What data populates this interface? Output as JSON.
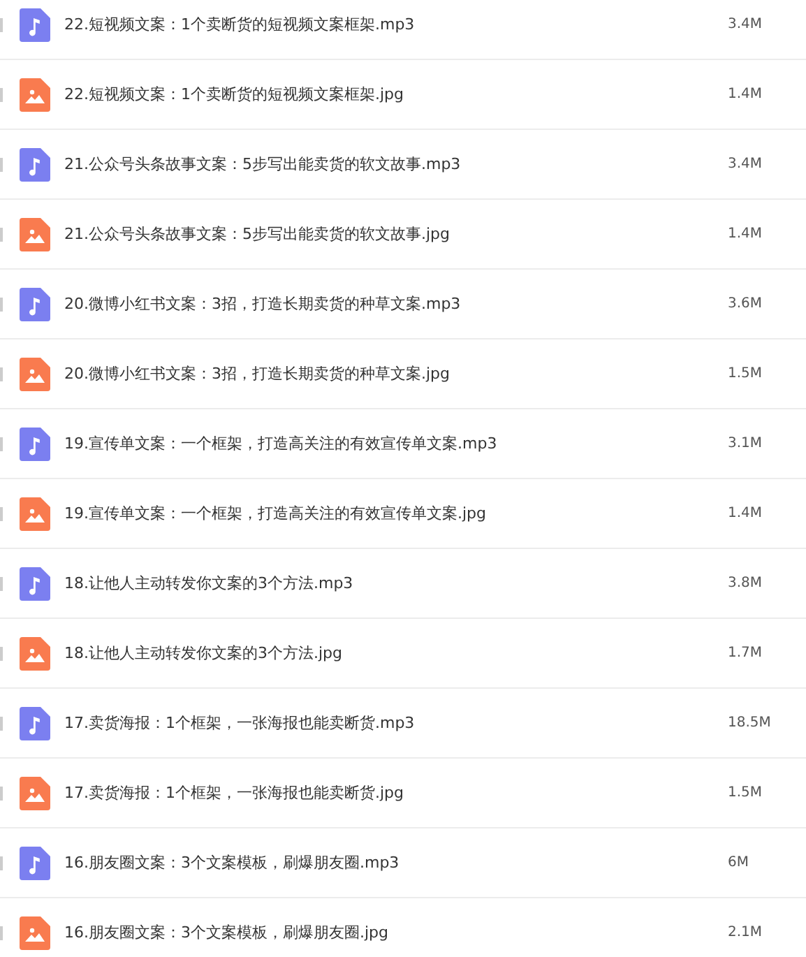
{
  "files": [
    {
      "kind": "audio",
      "name": "22.短视频文案：1个卖断货的短视频文案框架.mp3",
      "size": "3.4M"
    },
    {
      "kind": "image",
      "name": "22.短视频文案：1个卖断货的短视频文案框架.jpg",
      "size": "1.4M"
    },
    {
      "kind": "audio",
      "name": "21.公众号头条故事文案：5步写出能卖货的软文故事.mp3",
      "size": "3.4M"
    },
    {
      "kind": "image",
      "name": "21.公众号头条故事文案：5步写出能卖货的软文故事.jpg",
      "size": "1.4M"
    },
    {
      "kind": "audio",
      "name": "20.微博小红书文案：3招，打造长期卖货的种草文案.mp3",
      "size": "3.6M"
    },
    {
      "kind": "image",
      "name": "20.微博小红书文案：3招，打造长期卖货的种草文案.jpg",
      "size": "1.5M"
    },
    {
      "kind": "audio",
      "name": "19.宣传单文案：一个框架，打造高关注的有效宣传单文案.mp3",
      "size": "3.1M"
    },
    {
      "kind": "image",
      "name": "19.宣传单文案：一个框架，打造高关注的有效宣传单文案.jpg",
      "size": "1.4M"
    },
    {
      "kind": "audio",
      "name": "18.让他人主动转发你文案的3个方法.mp3",
      "size": "3.8M"
    },
    {
      "kind": "image",
      "name": "18.让他人主动转发你文案的3个方法.jpg",
      "size": "1.7M"
    },
    {
      "kind": "audio",
      "name": "17.卖货海报：1个框架，一张海报也能卖断货.mp3",
      "size": "18.5M"
    },
    {
      "kind": "image",
      "name": "17.卖货海报：1个框架，一张海报也能卖断货.jpg",
      "size": "1.5M"
    },
    {
      "kind": "audio",
      "name": "16.朋友圈文案：3个文案模板，刷爆朋友圈.mp3",
      "size": "6M"
    },
    {
      "kind": "image",
      "name": "16.朋友圈文案：3个文案模板，刷爆朋友圈.jpg",
      "size": "2.1M"
    }
  ]
}
